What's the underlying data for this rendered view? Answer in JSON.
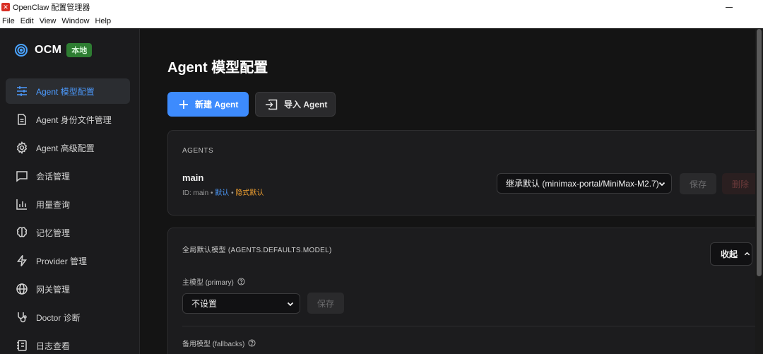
{
  "window": {
    "title": "OpenClaw 配置管理器"
  },
  "menu": [
    "File",
    "Edit",
    "View",
    "Window",
    "Help"
  ],
  "brand": {
    "name": "OCM",
    "badge": "本地"
  },
  "nav": [
    {
      "label": "Agent 模型配置",
      "icon": "sliders-icon",
      "active": true
    },
    {
      "label": "Agent 身份文件管理",
      "icon": "file-icon"
    },
    {
      "label": "Agent 高级配置",
      "icon": "gear-icon"
    },
    {
      "label": "会话管理",
      "icon": "chat-icon"
    },
    {
      "label": "用量查询",
      "icon": "bar-chart-icon"
    },
    {
      "label": "记忆管理",
      "icon": "brain-icon"
    },
    {
      "label": "Provider 管理",
      "icon": "lightning-icon"
    },
    {
      "label": "网关管理",
      "icon": "globe-icon"
    },
    {
      "label": "Doctor 诊断",
      "icon": "stethoscope-icon"
    },
    {
      "label": "日志查看",
      "icon": "log-icon"
    }
  ],
  "main": {
    "title": "Agent 模型配置",
    "new_agent": "新建 Agent",
    "import_agent": "导入 Agent",
    "agents_section": {
      "label": "AGENTS",
      "agent": {
        "name": "main",
        "id_text": "ID: main",
        "sep": " • ",
        "tag_default": "默认",
        "tag_implicit": "隐式默认",
        "model_select": "继承默认 (minimax-portal/MiniMax-M2.7)",
        "save": "保存",
        "delete": "删除"
      }
    },
    "defaults_section": {
      "title": "全局默认模型 (AGENTS.DEFAULTS.MODEL)",
      "collapse": "收起",
      "primary_label": "主模型 (primary)",
      "primary_value": "不设置",
      "save": "保存",
      "fallbacks_label": "备用模型 (fallbacks)"
    }
  },
  "colors": {
    "accent": "#3d8bfd",
    "badge": "#2e7d32",
    "orange": "#f0a030"
  }
}
